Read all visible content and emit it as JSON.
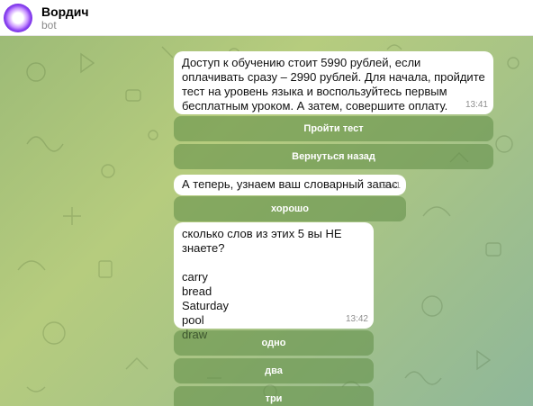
{
  "header": {
    "title": "Вордич",
    "subtitle": "bot"
  },
  "messages": [
    {
      "text": "Доступ к обучению стоит 5990 рублей, если оплачивать сразу – 2990 рублей. Для начала, пройдите тест на уровень языка и воспользуйтесь первым бесплатным уроком. А затем, совершите оплату.",
      "time": "13:41",
      "buttons": [
        "Пройти тест",
        "Вернуться назад"
      ]
    },
    {
      "text": "А теперь, узнаем ваш словарный запас",
      "time": "13:41",
      "buttons": [
        "хорошо"
      ]
    },
    {
      "text": "сколько слов из этих 5 вы НЕ знаете?\n\ncarry\nbread\nSaturday\npool\ndraw",
      "time": "13:42",
      "buttons": [
        "одно",
        "два",
        "три"
      ]
    }
  ]
}
